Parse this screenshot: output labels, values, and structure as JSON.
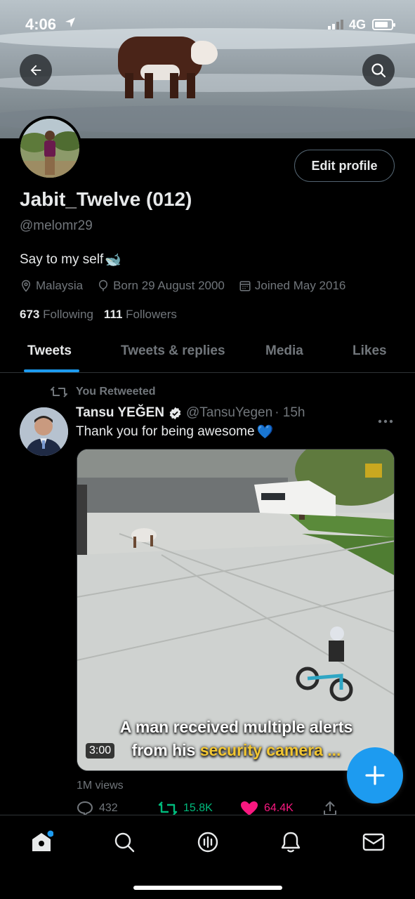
{
  "status_bar": {
    "time": "4:06",
    "network": "4G"
  },
  "profile": {
    "name": "Jabit_Twelve (012)",
    "handle": "@melomr29",
    "bio": "Say to my self",
    "bio_emoji": "🐋",
    "location": "Malaysia",
    "birthday": "Born 29 August 2000",
    "joined": "Joined May 2016",
    "following_count": "673",
    "following_label": "Following",
    "followers_count": "111",
    "followers_label": "Followers",
    "edit_label": "Edit profile"
  },
  "tabs": [
    {
      "label": "Tweets",
      "active": true
    },
    {
      "label": "Tweets & replies",
      "active": false
    },
    {
      "label": "Media",
      "active": false
    },
    {
      "label": "Likes",
      "active": false
    }
  ],
  "tweet": {
    "retweet_label": "You Retweeted",
    "author_name": "Tansu YEĞEN",
    "author_handle": "@TansuYegen",
    "time": "· 15h",
    "text": "Thank you for being awesome",
    "text_emoji": "💙",
    "video": {
      "caption_line1": "A man received multiple alerts",
      "caption_line2_pre": "from his ",
      "caption_line2_highlight": "security camera ...",
      "duration": "3:00"
    },
    "views": "1M views",
    "replies": "432",
    "retweets": "15.8K",
    "likes": "64.4K"
  },
  "colors": {
    "accent": "#1d9bf0",
    "retweet_green": "#00ba7c",
    "like_pink": "#f91880",
    "muted": "#71767b",
    "caption_highlight": "#f2c632"
  },
  "icons": {
    "back": "arrow-left-icon",
    "search": "search-icon",
    "location": "location-pin-icon",
    "birthday": "balloon-icon",
    "calendar": "calendar-icon",
    "retweet": "retweet-icon",
    "verified": "verified-badge-icon",
    "reply": "reply-icon",
    "like": "heart-icon",
    "share": "share-icon",
    "compose": "plus-icon",
    "home": "home-icon",
    "explore": "search-icon",
    "spaces": "spaces-icon",
    "notifications": "bell-icon",
    "messages": "mail-icon"
  }
}
